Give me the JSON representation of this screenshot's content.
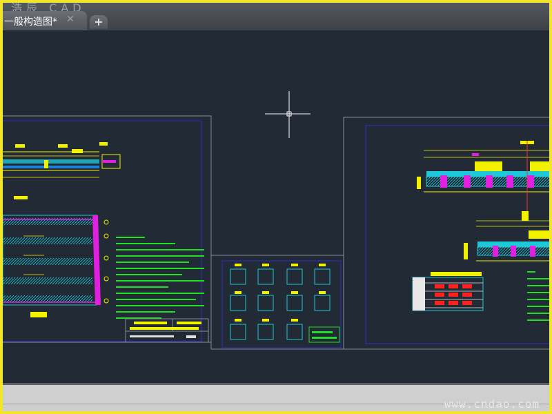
{
  "brand": "浩辰 CAD",
  "tabs": [
    {
      "label": "一般构造图*",
      "close_icon": "close-icon"
    }
  ],
  "add_tab_icon": "plus-icon",
  "canvas": {
    "background": "#222a35",
    "crosshair": "crosshair-cursor"
  },
  "status_bar": {
    "watermark": "www.cndao.com"
  }
}
